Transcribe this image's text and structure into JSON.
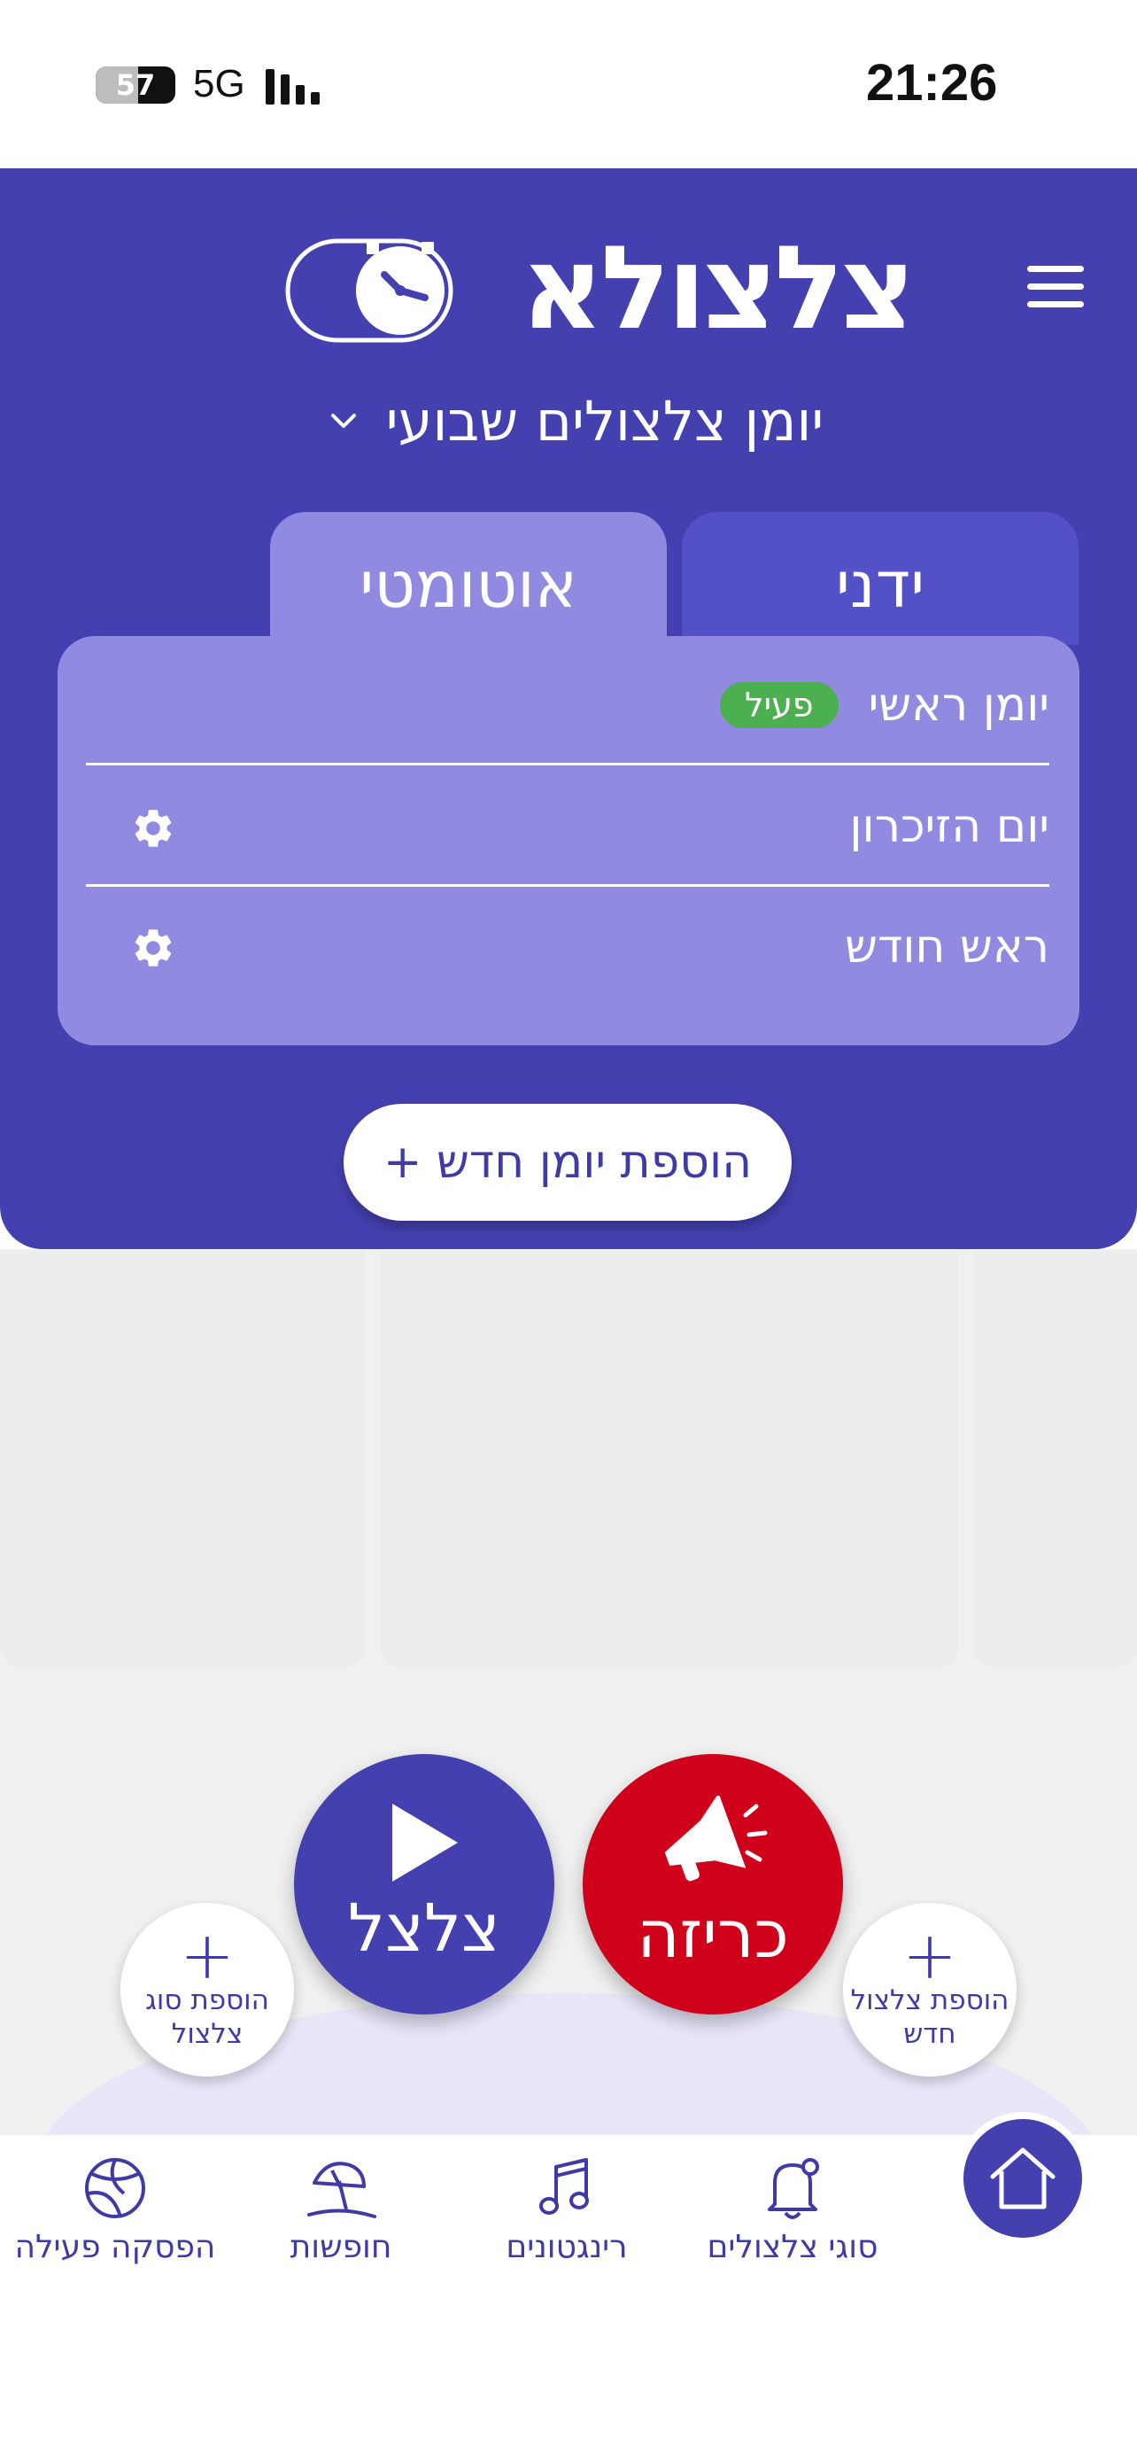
{
  "status_bar": {
    "battery": "57",
    "network": "5G",
    "time": "21:26"
  },
  "header": {
    "logo_text": "צלצולא",
    "diary_selector": "יומן צלצולים שבועי",
    "tabs": [
      {
        "label": "ידני"
      },
      {
        "label": "אוטומטי"
      }
    ]
  },
  "diaries": [
    {
      "name": "יומן ראשי",
      "badge": "פעיל"
    },
    {
      "name": "יום הזיכרון"
    },
    {
      "name": "ראש חודש"
    }
  ],
  "add_diary_label": "הוספת יומן חדש +",
  "actions": {
    "ring_label": "צלצל",
    "emergency_label": "כריזה",
    "add_type": {
      "plus": "+",
      "line1": "הוספת סוג",
      "line2": "צלצול"
    },
    "add_ring": {
      "plus": "+",
      "line1": "הוספת צלצול",
      "line2": "חדש"
    }
  },
  "nav": [
    {
      "label": "סוגי צלצולים",
      "icon": "bell-icon"
    },
    {
      "label": "רינגטונים",
      "icon": "music-note-icon"
    },
    {
      "label": "חופשות",
      "icon": "beach-umbrella-icon"
    },
    {
      "label": "הפסקה פעילה",
      "icon": "ball-icon"
    }
  ],
  "colors": {
    "primary": "#4540b0",
    "panel": "#908ae0",
    "active_tab": "#5450c8",
    "emergency": "#d0021b",
    "badge": "#4caf50"
  }
}
